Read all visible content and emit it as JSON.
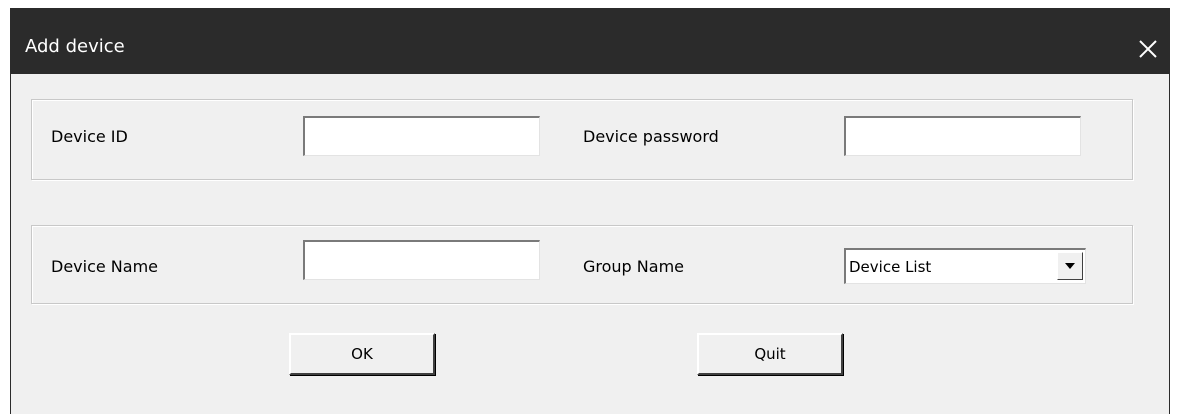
{
  "window": {
    "title": "Add device",
    "close_icon": "close-icon"
  },
  "group_1": {
    "device_id_label": "Device ID",
    "device_id_value": "",
    "device_password_label": "Device password",
    "device_password_value": ""
  },
  "group_2": {
    "device_name_label": "Device Name",
    "device_name_value": "",
    "group_name_label": "Group Name",
    "group_name_selected": "Device List",
    "dropdown_icon": "chevron-down-icon"
  },
  "buttons": {
    "ok_label": "OK",
    "quit_label": "Quit"
  },
  "colors": {
    "titlebar": "#2b2b2b",
    "dialog_bg": "#f0f0f0"
  }
}
